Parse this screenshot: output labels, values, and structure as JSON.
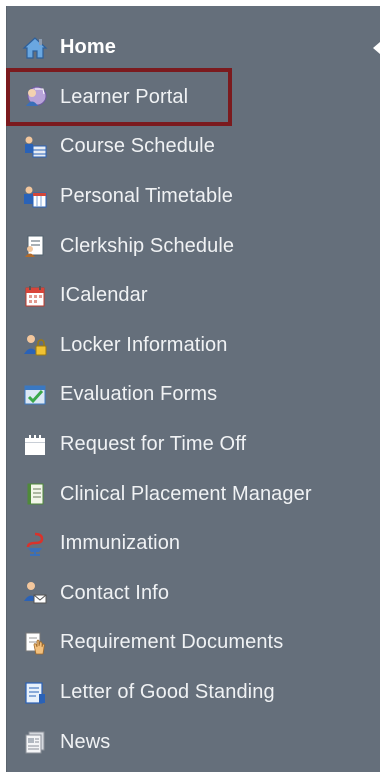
{
  "nav": {
    "items": [
      {
        "label": "Home",
        "icon": "home-icon"
      },
      {
        "label": "Learner Portal",
        "icon": "learner-portal-icon"
      },
      {
        "label": "Course Schedule",
        "icon": "course-schedule-icon"
      },
      {
        "label": "Personal Timetable",
        "icon": "personal-timetable-icon"
      },
      {
        "label": "Clerkship Schedule",
        "icon": "clerkship-schedule-icon"
      },
      {
        "label": "ICalendar",
        "icon": "calendar-icon"
      },
      {
        "label": "Locker Information",
        "icon": "locker-icon"
      },
      {
        "label": "Evaluation Forms",
        "icon": "evaluation-forms-icon"
      },
      {
        "label": "Request for Time Off",
        "icon": "time-off-calendar-icon"
      },
      {
        "label": "Clinical Placement Manager",
        "icon": "clinical-placement-icon"
      },
      {
        "label": "Immunization",
        "icon": "immunization-icon"
      },
      {
        "label": "Contact Info",
        "icon": "contact-info-icon"
      },
      {
        "label": "Requirement Documents",
        "icon": "requirement-documents-icon"
      },
      {
        "label": "Letter of Good Standing",
        "icon": "letter-document-icon"
      },
      {
        "label": "News",
        "icon": "news-icon"
      }
    ]
  },
  "colors": {
    "sidebar_bg": "#656f7b",
    "highlight_border": "#7b1a1e",
    "text": "#f0f2f4"
  }
}
